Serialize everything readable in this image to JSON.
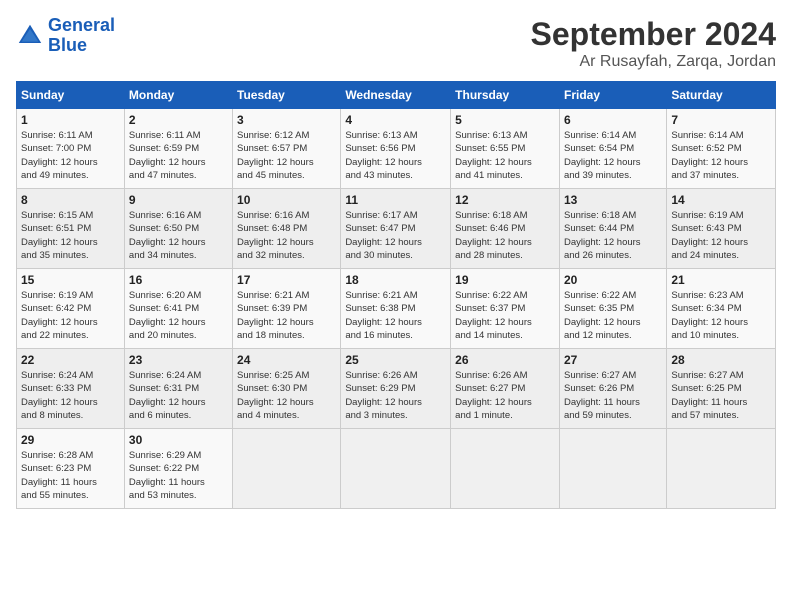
{
  "header": {
    "logo_line1": "General",
    "logo_line2": "Blue",
    "title": "September 2024",
    "subtitle": "Ar Rusayfah, Zarqa, Jordan"
  },
  "weekdays": [
    "Sunday",
    "Monday",
    "Tuesday",
    "Wednesday",
    "Thursday",
    "Friday",
    "Saturday"
  ],
  "weeks": [
    [
      {
        "day": "1",
        "info": "Sunrise: 6:11 AM\nSunset: 7:00 PM\nDaylight: 12 hours\nand 49 minutes."
      },
      {
        "day": "2",
        "info": "Sunrise: 6:11 AM\nSunset: 6:59 PM\nDaylight: 12 hours\nand 47 minutes."
      },
      {
        "day": "3",
        "info": "Sunrise: 6:12 AM\nSunset: 6:57 PM\nDaylight: 12 hours\nand 45 minutes."
      },
      {
        "day": "4",
        "info": "Sunrise: 6:13 AM\nSunset: 6:56 PM\nDaylight: 12 hours\nand 43 minutes."
      },
      {
        "day": "5",
        "info": "Sunrise: 6:13 AM\nSunset: 6:55 PM\nDaylight: 12 hours\nand 41 minutes."
      },
      {
        "day": "6",
        "info": "Sunrise: 6:14 AM\nSunset: 6:54 PM\nDaylight: 12 hours\nand 39 minutes."
      },
      {
        "day": "7",
        "info": "Sunrise: 6:14 AM\nSunset: 6:52 PM\nDaylight: 12 hours\nand 37 minutes."
      }
    ],
    [
      {
        "day": "8",
        "info": "Sunrise: 6:15 AM\nSunset: 6:51 PM\nDaylight: 12 hours\nand 35 minutes."
      },
      {
        "day": "9",
        "info": "Sunrise: 6:16 AM\nSunset: 6:50 PM\nDaylight: 12 hours\nand 34 minutes."
      },
      {
        "day": "10",
        "info": "Sunrise: 6:16 AM\nSunset: 6:48 PM\nDaylight: 12 hours\nand 32 minutes."
      },
      {
        "day": "11",
        "info": "Sunrise: 6:17 AM\nSunset: 6:47 PM\nDaylight: 12 hours\nand 30 minutes."
      },
      {
        "day": "12",
        "info": "Sunrise: 6:18 AM\nSunset: 6:46 PM\nDaylight: 12 hours\nand 28 minutes."
      },
      {
        "day": "13",
        "info": "Sunrise: 6:18 AM\nSunset: 6:44 PM\nDaylight: 12 hours\nand 26 minutes."
      },
      {
        "day": "14",
        "info": "Sunrise: 6:19 AM\nSunset: 6:43 PM\nDaylight: 12 hours\nand 24 minutes."
      }
    ],
    [
      {
        "day": "15",
        "info": "Sunrise: 6:19 AM\nSunset: 6:42 PM\nDaylight: 12 hours\nand 22 minutes."
      },
      {
        "day": "16",
        "info": "Sunrise: 6:20 AM\nSunset: 6:41 PM\nDaylight: 12 hours\nand 20 minutes."
      },
      {
        "day": "17",
        "info": "Sunrise: 6:21 AM\nSunset: 6:39 PM\nDaylight: 12 hours\nand 18 minutes."
      },
      {
        "day": "18",
        "info": "Sunrise: 6:21 AM\nSunset: 6:38 PM\nDaylight: 12 hours\nand 16 minutes."
      },
      {
        "day": "19",
        "info": "Sunrise: 6:22 AM\nSunset: 6:37 PM\nDaylight: 12 hours\nand 14 minutes."
      },
      {
        "day": "20",
        "info": "Sunrise: 6:22 AM\nSunset: 6:35 PM\nDaylight: 12 hours\nand 12 minutes."
      },
      {
        "day": "21",
        "info": "Sunrise: 6:23 AM\nSunset: 6:34 PM\nDaylight: 12 hours\nand 10 minutes."
      }
    ],
    [
      {
        "day": "22",
        "info": "Sunrise: 6:24 AM\nSunset: 6:33 PM\nDaylight: 12 hours\nand 8 minutes."
      },
      {
        "day": "23",
        "info": "Sunrise: 6:24 AM\nSunset: 6:31 PM\nDaylight: 12 hours\nand 6 minutes."
      },
      {
        "day": "24",
        "info": "Sunrise: 6:25 AM\nSunset: 6:30 PM\nDaylight: 12 hours\nand 4 minutes."
      },
      {
        "day": "25",
        "info": "Sunrise: 6:26 AM\nSunset: 6:29 PM\nDaylight: 12 hours\nand 3 minutes."
      },
      {
        "day": "26",
        "info": "Sunrise: 6:26 AM\nSunset: 6:27 PM\nDaylight: 12 hours\nand 1 minute."
      },
      {
        "day": "27",
        "info": "Sunrise: 6:27 AM\nSunset: 6:26 PM\nDaylight: 11 hours\nand 59 minutes."
      },
      {
        "day": "28",
        "info": "Sunrise: 6:27 AM\nSunset: 6:25 PM\nDaylight: 11 hours\nand 57 minutes."
      }
    ],
    [
      {
        "day": "29",
        "info": "Sunrise: 6:28 AM\nSunset: 6:23 PM\nDaylight: 11 hours\nand 55 minutes."
      },
      {
        "day": "30",
        "info": "Sunrise: 6:29 AM\nSunset: 6:22 PM\nDaylight: 11 hours\nand 53 minutes."
      },
      {
        "day": "",
        "info": ""
      },
      {
        "day": "",
        "info": ""
      },
      {
        "day": "",
        "info": ""
      },
      {
        "day": "",
        "info": ""
      },
      {
        "day": "",
        "info": ""
      }
    ]
  ]
}
